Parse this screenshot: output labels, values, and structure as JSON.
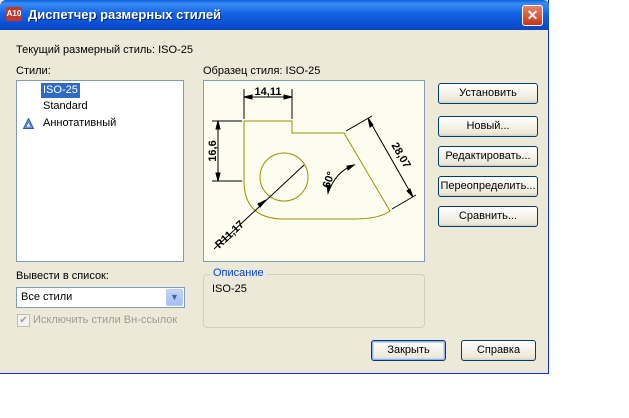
{
  "window": {
    "title": "Диспетчер размерных стилей",
    "app_icon_text": "A10",
    "close_label": "✕"
  },
  "current_style_label": "Текущий размерный стиль: ISO-25",
  "styles": {
    "label": "Стили:",
    "items": [
      {
        "label": "ISO-25",
        "selected": true,
        "icon": null
      },
      {
        "label": "Standard",
        "selected": false,
        "icon": null
      },
      {
        "label": "Аннотативный",
        "selected": false,
        "icon": "annotative-icon"
      }
    ]
  },
  "list_filter": {
    "label": "Вывести в список:",
    "value": "Все стили"
  },
  "exclude_xref": {
    "label": "Исключить стили Вн-ссылок",
    "checked": true,
    "disabled": true
  },
  "preview": {
    "label": "Образец стиля: ISO-25",
    "dimensions": {
      "top": "14,11",
      "left": "16,6",
      "right": "28,07",
      "angle": "60°",
      "radius": "R11,17"
    }
  },
  "description": {
    "title": "Описание",
    "text": "ISO-25"
  },
  "buttons": {
    "set_current": "Установить",
    "new": "Новый...",
    "modify": "Редактировать...",
    "override": "Переопределить...",
    "compare": "Сравнить...",
    "close": "Закрыть",
    "help": "Справка"
  },
  "colors": {
    "titlebar": "#0a5fdc",
    "selection": "#316ac5",
    "drawing_line": "#9a9000",
    "group_title": "#0046d5"
  }
}
